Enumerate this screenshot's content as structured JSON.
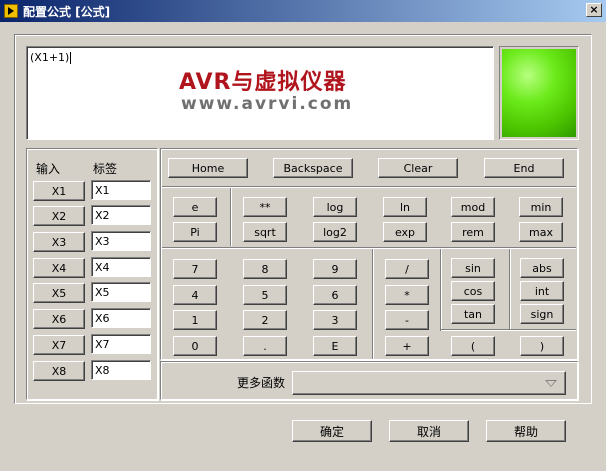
{
  "window": {
    "title": "配置公式 [公式]",
    "close_label": "×"
  },
  "formula": {
    "value": "(X1+1)"
  },
  "watermark": {
    "line1": "AVR与虚拟仪器",
    "line2": "www.avrvi.com"
  },
  "inputs": {
    "header_input": "输入",
    "header_label": "标签",
    "items": [
      {
        "button": "X1",
        "value": "X1"
      },
      {
        "button": "X2",
        "value": "X2"
      },
      {
        "button": "X3",
        "value": "X3"
      },
      {
        "button": "X4",
        "value": "X4"
      },
      {
        "button": "X5",
        "value": "X5"
      },
      {
        "button": "X6",
        "value": "X6"
      },
      {
        "button": "X7",
        "value": "X7"
      },
      {
        "button": "X8",
        "value": "X8"
      }
    ]
  },
  "nav": {
    "home": "Home",
    "backspace": "Backspace",
    "clear": "Clear",
    "end": "End"
  },
  "constants": {
    "e": "e",
    "pi": "Pi"
  },
  "funcs": {
    "pow": "**",
    "log": "log",
    "ln": "ln",
    "mod": "mod",
    "min": "min",
    "sqrt": "sqrt",
    "log2": "log2",
    "exp": "exp",
    "rem": "rem",
    "max": "max"
  },
  "digits": {
    "d7": "7",
    "d8": "8",
    "d9": "9",
    "d4": "4",
    "d5": "5",
    "d6": "6",
    "d1": "1",
    "d2": "2",
    "d3": "3",
    "d0": "0",
    "dot": ".",
    "E": "E"
  },
  "ops": {
    "div": "/",
    "mul": "*",
    "sub": "-",
    "add": "+"
  },
  "trig": {
    "sin": "sin",
    "cos": "cos",
    "tan": "tan",
    "abs": "abs",
    "int": "int",
    "sign": "sign"
  },
  "parens": {
    "open": "(",
    "close": ")"
  },
  "more": {
    "label": "更多函数",
    "selected": ""
  },
  "footer": {
    "ok": "确定",
    "cancel": "取消",
    "help": "帮助"
  },
  "colors": {
    "led": "#4cc400",
    "watermark": "#b0141c",
    "titlebar": "#0a246a"
  }
}
